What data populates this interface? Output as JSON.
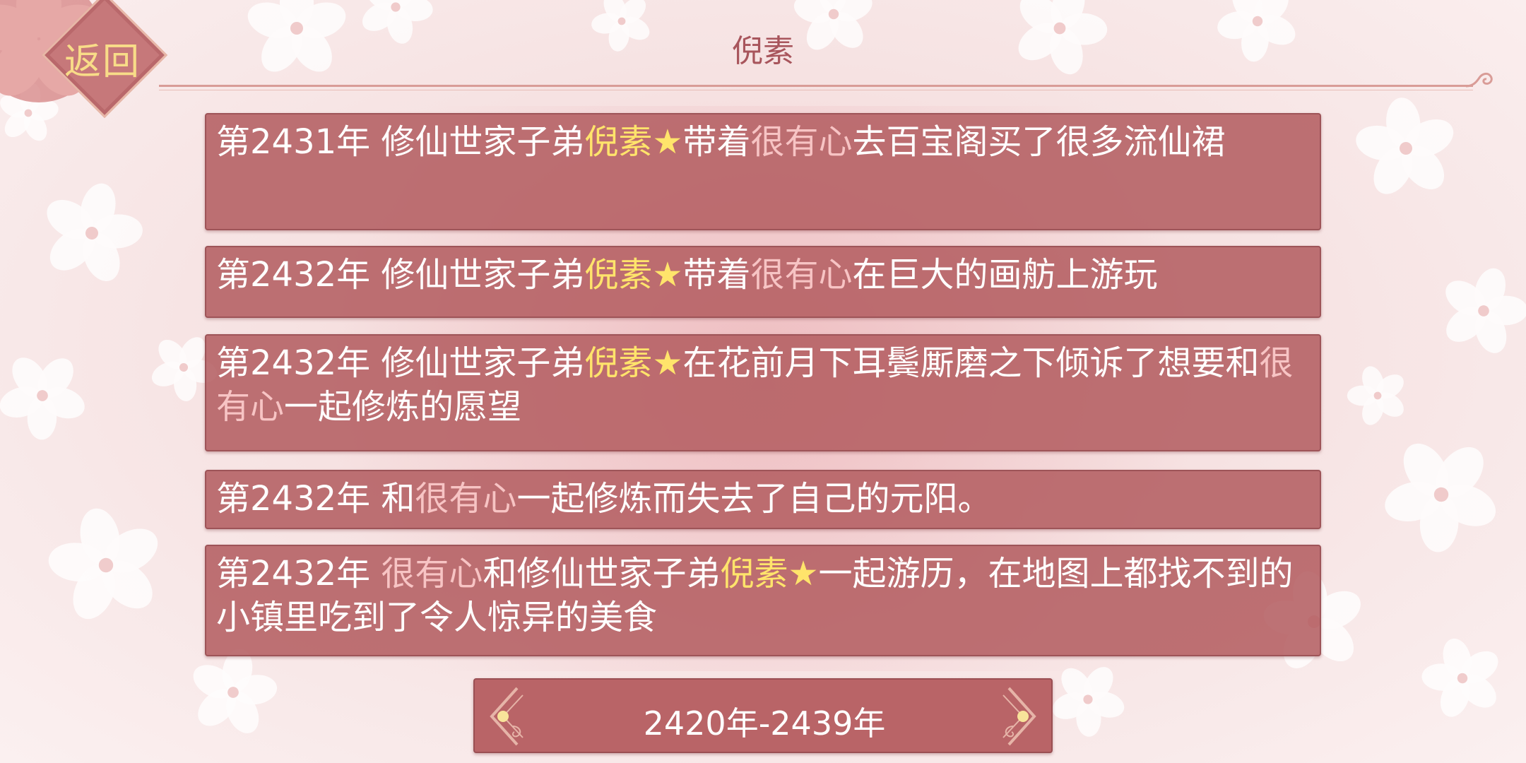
{
  "header": {
    "title": "倪素",
    "back_label": "返回"
  },
  "events": [
    [
      {
        "t": "第2431年 修仙世家子弟",
        "c": "normal"
      },
      {
        "t": "倪素★",
        "c": "yellow"
      },
      {
        "t": "带着",
        "c": "normal"
      },
      {
        "t": "很有心",
        "c": "pink"
      },
      {
        "t": "去百宝阁买了很多流仙裙",
        "c": "normal"
      }
    ],
    [
      {
        "t": "第2432年 修仙世家子弟",
        "c": "normal"
      },
      {
        "t": "倪素★",
        "c": "yellow"
      },
      {
        "t": "带着",
        "c": "normal"
      },
      {
        "t": "很有心",
        "c": "pink"
      },
      {
        "t": "在巨大的画舫上游玩",
        "c": "normal"
      }
    ],
    [
      {
        "t": "第2432年 修仙世家子弟",
        "c": "normal"
      },
      {
        "t": "倪素★",
        "c": "yellow"
      },
      {
        "t": "在花前月下耳鬓厮磨之下倾诉了想要和",
        "c": "normal"
      },
      {
        "t": "很有心",
        "c": "pink"
      },
      {
        "t": "一起修炼的愿望",
        "c": "normal"
      }
    ],
    [
      {
        "t": "第2432年 和",
        "c": "normal"
      },
      {
        "t": "很有心",
        "c": "pink"
      },
      {
        "t": "一起修炼而失去了自己的元阳。",
        "c": "normal"
      }
    ],
    [
      {
        "t": "第2432年 ",
        "c": "normal"
      },
      {
        "t": "很有心",
        "c": "pink"
      },
      {
        "t": "和修仙世家子弟",
        "c": "normal"
      },
      {
        "t": "倪素★",
        "c": "yellow"
      },
      {
        "t": "一起游历，在地图上都找不到的小镇里吃到了令人惊异的美食",
        "c": "normal"
      }
    ]
  ],
  "era_selector": {
    "label": "2420年-2439年"
  },
  "colors": {
    "card_bg": "#b45f62",
    "highlight_name": "#ffe46b",
    "highlight_partner": "#f7c4c4",
    "title_text": "#a8555c",
    "back_text": "#f8dc88"
  }
}
